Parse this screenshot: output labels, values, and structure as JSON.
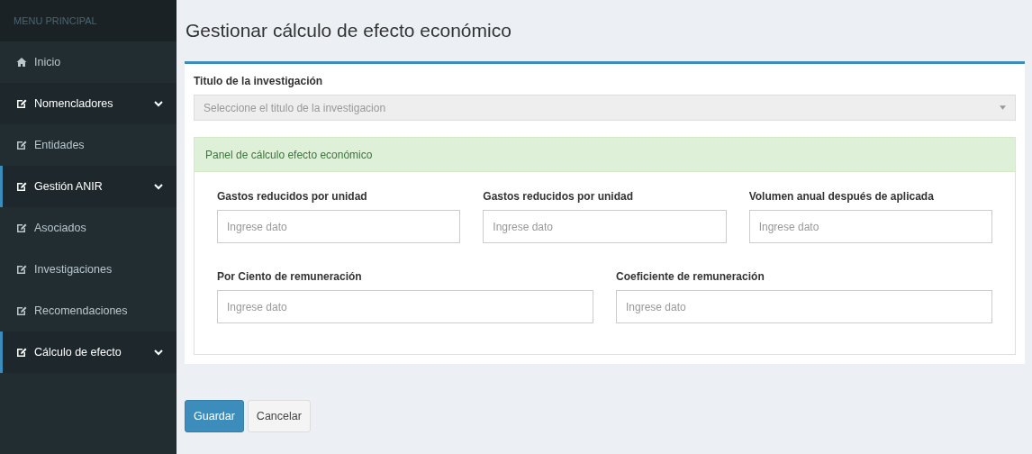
{
  "sidebar": {
    "header": "MENU PRINCIPAL",
    "items": [
      {
        "kind": "link",
        "label": "Inicio"
      },
      {
        "kind": "group",
        "label": "Nomencladores",
        "active": false
      },
      {
        "kind": "sub",
        "label": "Entidades"
      },
      {
        "kind": "group",
        "label": "Gestión ANIR",
        "active": true
      },
      {
        "kind": "sub",
        "label": "Asociados"
      },
      {
        "kind": "sub",
        "label": "Investigaciones"
      },
      {
        "kind": "sub",
        "label": "Recomendaciones"
      },
      {
        "kind": "group",
        "label": "Cálculo de efecto",
        "active": true
      }
    ]
  },
  "page_title": "Gestionar cálculo de efecto económico",
  "form": {
    "select_label": "Titulo de la investigación",
    "select_placeholder": "Seleccione el titulo de la investigacion",
    "panel": {
      "title": "Panel de cálculo efecto económico",
      "rows": [
        [
          {
            "label": "Gastos reducidos por unidad",
            "placeholder": "Ingrese dato"
          },
          {
            "label": "Gastos reducidos por unidad",
            "placeholder": "Ingrese dato"
          },
          {
            "label": "Volumen anual después de aplicada",
            "placeholder": "Ingrese dato"
          }
        ],
        [
          {
            "label": "Por Ciento de remuneración",
            "placeholder": "Ingrese dato"
          },
          {
            "label": "Coeficiente de remuneración",
            "placeholder": "Ingrese dato"
          }
        ]
      ]
    }
  },
  "buttons": [
    {
      "kind": "primary",
      "label": "Guardar"
    },
    {
      "kind": "default",
      "label": "Cancelar"
    }
  ]
}
